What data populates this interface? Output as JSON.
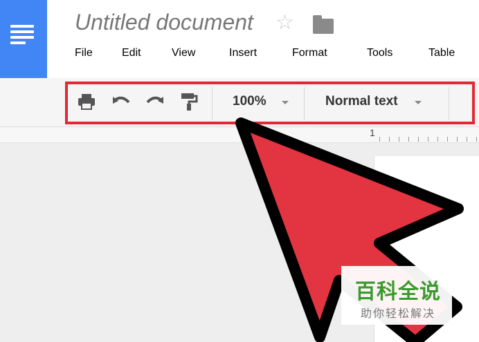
{
  "document": {
    "title": "Untitled document"
  },
  "icons": {
    "star": "star-icon",
    "folder": "folder-icon",
    "logo": "docs-logo-icon"
  },
  "menu": [
    "File",
    "Edit",
    "View",
    "Insert",
    "Format",
    "Tools",
    "Table"
  ],
  "toolbar": {
    "zoom": "100%",
    "style": "Normal text",
    "buttons": [
      "print-icon",
      "undo-icon",
      "redo-icon",
      "paint-format-icon"
    ]
  },
  "ruler": {
    "mark": "1"
  },
  "colors": {
    "brand": "#4285f4",
    "highlight": "#e12933",
    "arrow": "#e23441"
  },
  "watermark": {
    "main": "百科全说",
    "sub": "助你轻松解决"
  }
}
